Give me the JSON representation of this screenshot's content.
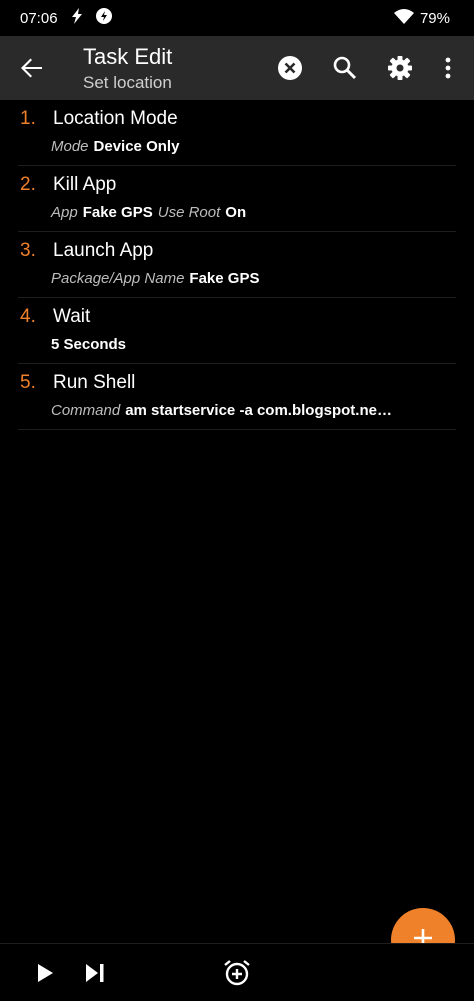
{
  "status": {
    "time": "07:06",
    "battery": "79%"
  },
  "appbar": {
    "title": "Task Edit",
    "subtitle": "Set location"
  },
  "actions": [
    {
      "number": "1.",
      "name": "Location Mode",
      "params": [
        {
          "label": "Mode",
          "value": "Device Only"
        }
      ]
    },
    {
      "number": "2.",
      "name": "Kill App",
      "params": [
        {
          "label": "App",
          "value": "Fake GPS"
        },
        {
          "label": "Use Root",
          "value": "On"
        }
      ]
    },
    {
      "number": "3.",
      "name": "Launch App",
      "params": [
        {
          "label": "Package/App Name",
          "value": "Fake GPS"
        }
      ]
    },
    {
      "number": "4.",
      "name": "Wait",
      "params": [
        {
          "label": "",
          "value": "5 Seconds"
        }
      ]
    },
    {
      "number": "5.",
      "name": "Run Shell",
      "params": [
        {
          "label": "Command",
          "value": "am startservice -a com.blogspot.ne…"
        }
      ]
    }
  ],
  "colors": {
    "accent": "#f0812b",
    "appbar": "#2a2a2a",
    "background": "#000000"
  },
  "icons": {
    "back": "arrow-left-icon",
    "clear": "close-circle-icon",
    "search": "search-icon",
    "settings": "gear-icon",
    "menu": "more-vert-icon",
    "add": "plus-icon",
    "play": "play-icon",
    "step": "skip-next-icon",
    "timer": "add-alarm-icon"
  }
}
